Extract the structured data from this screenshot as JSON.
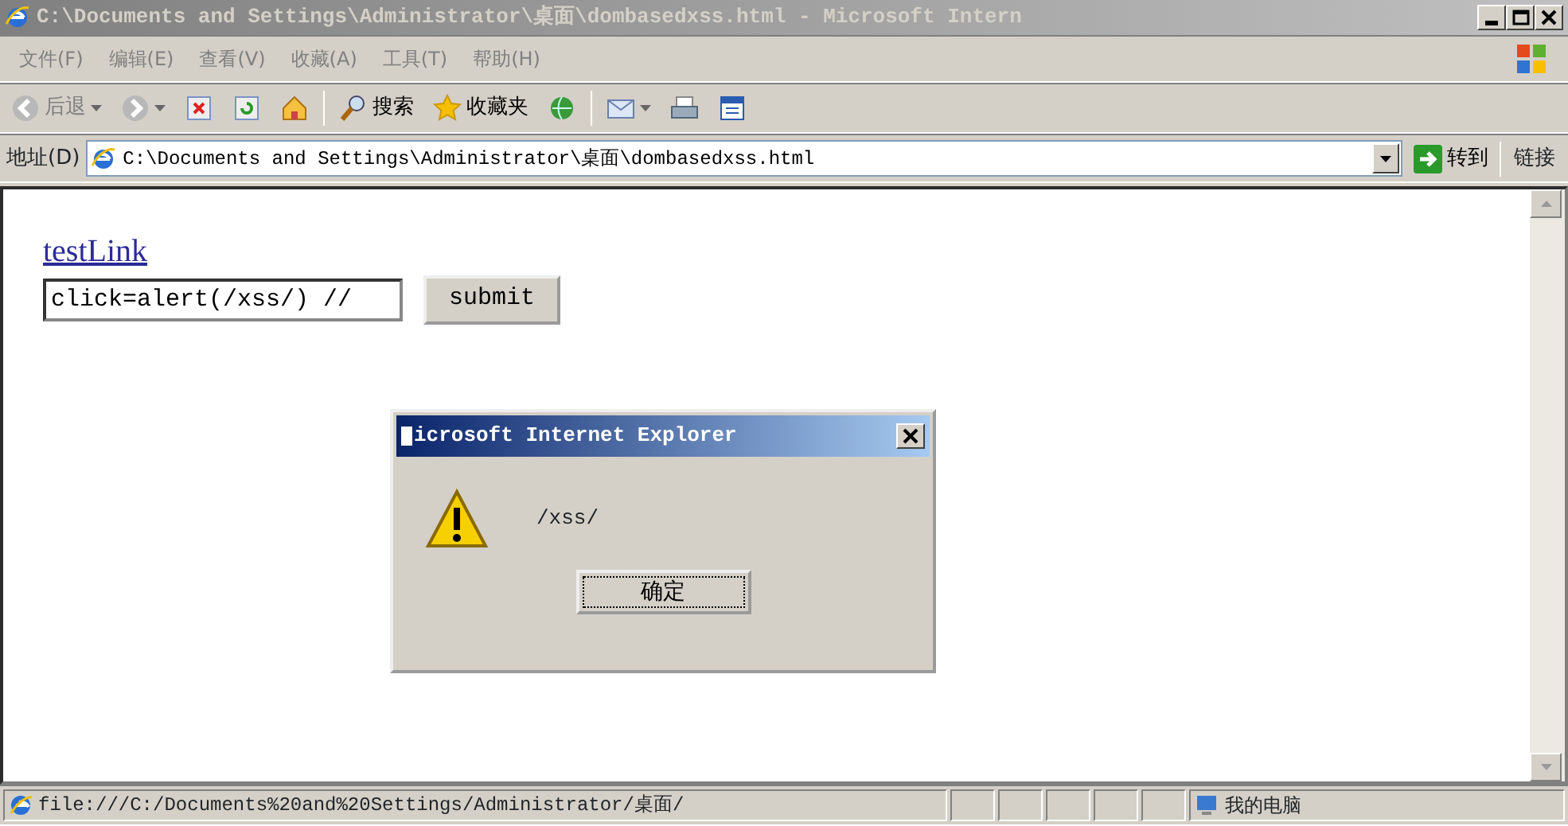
{
  "window": {
    "title": "C:\\Documents and Settings\\Administrator\\桌面\\dombasedxss.html - Microsoft Intern",
    "active": false
  },
  "menu": [
    "文件(F)",
    "编辑(E)",
    "查看(V)",
    "收藏(A)",
    "工具(T)",
    "帮助(H)"
  ],
  "toolbar": [
    {
      "kind": "back",
      "label": "后退",
      "dropdown": true
    },
    {
      "kind": "forward",
      "dropdown": true
    },
    {
      "kind": "stop"
    },
    {
      "kind": "refresh"
    },
    {
      "kind": "home"
    },
    {
      "kind": "search",
      "label": "搜索"
    },
    {
      "kind": "favorites",
      "label": "收藏夹"
    },
    {
      "kind": "media"
    },
    {
      "kind": "mail",
      "dropdown": true
    },
    {
      "kind": "print"
    },
    {
      "kind": "edit"
    }
  ],
  "address_bar": {
    "label": "地址(D)",
    "value": "C:\\Documents and Settings\\Administrator\\桌面\\dombasedxss.html",
    "go": "转到",
    "links": "链接"
  },
  "page": {
    "link": "testLink",
    "input_value": "click=alert(/xss/) //",
    "button": "submit"
  },
  "dialog": {
    "title": "icrosoft Internet Explorer",
    "message": "/xss/",
    "ok": "确定"
  },
  "status_bar": {
    "text": "file:///C:/Documents%20and%20Settings/Administrator/桌面/",
    "zone": "我的电脑"
  }
}
